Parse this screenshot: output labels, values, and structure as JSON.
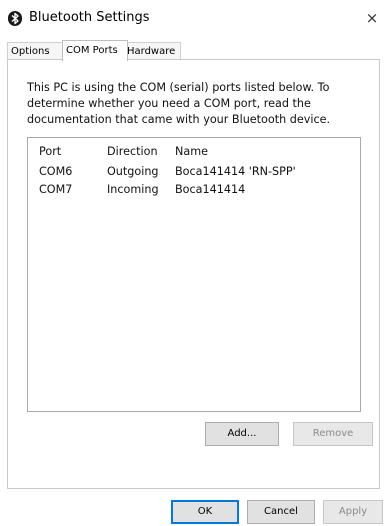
{
  "window": {
    "title": "Bluetooth Settings",
    "close_glyph": "×"
  },
  "tabs": [
    {
      "label": "Options"
    },
    {
      "label": "COM Ports"
    },
    {
      "label": "Hardware"
    }
  ],
  "com_ports": {
    "description": "This PC is using the COM (serial) ports listed below. To determine whether you need a COM port, read the documentation that came with your Bluetooth device.",
    "columns": {
      "port": "Port",
      "direction": "Direction",
      "name": "Name"
    },
    "rows": [
      {
        "port": "COM6",
        "direction": "Outgoing",
        "name": "Boca141414 'RN-SPP'"
      },
      {
        "port": "COM7",
        "direction": "Incoming",
        "name": "Boca141414"
      }
    ],
    "add_label": "Add...",
    "remove_label": "Remove"
  },
  "footer": {
    "ok_label": "OK",
    "cancel_label": "Cancel",
    "apply_label": "Apply"
  },
  "icons": {
    "app": "bluetooth-icon",
    "close": "close-icon"
  },
  "colors": {
    "default_button_border": "#0078d7",
    "disabled_text": "#8a8a8a"
  }
}
